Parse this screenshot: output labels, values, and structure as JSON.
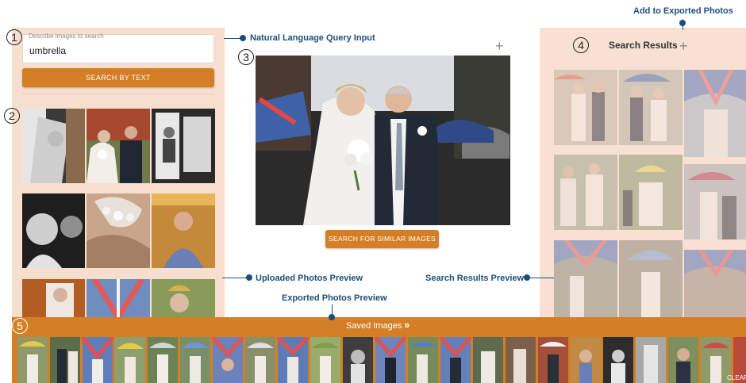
{
  "search": {
    "label": "Describe images to search",
    "value": "umbrella",
    "button": "SEARCH BY TEXT"
  },
  "main": {
    "similar_button": "SEARCH FOR SIMILAR IMAGES",
    "add_icon": "plus-icon"
  },
  "results": {
    "title": "Search Results",
    "add_icon": "plus-icon"
  },
  "saved": {
    "label": "Saved Images",
    "chevron": "»",
    "clear": "CLEAR"
  },
  "callouts": {
    "add_exported": "Add to Exported Photos",
    "nl_query": "Natural Language Query Input",
    "uploaded": "Uploaded Photos Preview",
    "search_results": "Search Results Preview",
    "exported": "Exported Photos Preview"
  },
  "markers": [
    "1",
    "2",
    "3",
    "4",
    "5"
  ],
  "colors": {
    "accent": "#d47f26",
    "panel": "#f7dfcf",
    "callout": "#1b4f7a"
  }
}
